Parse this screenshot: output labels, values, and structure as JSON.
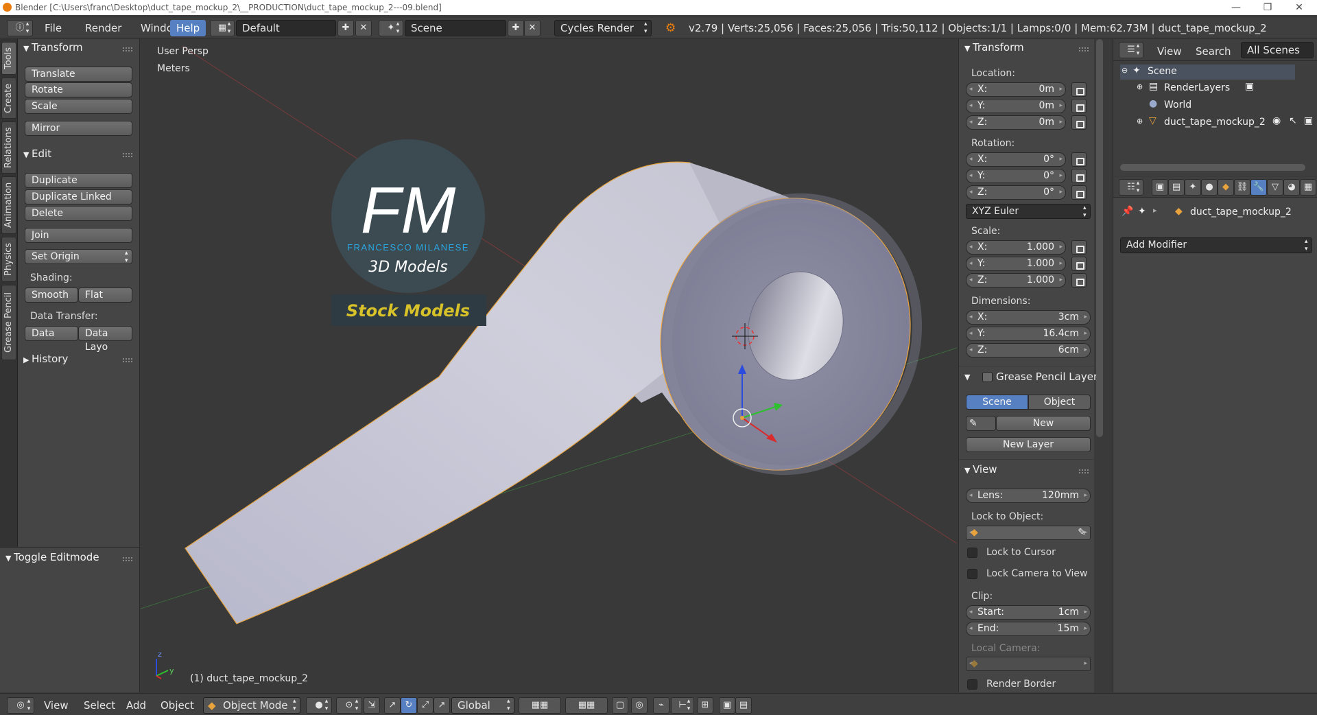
{
  "window": {
    "title": "Blender [C:\\Users\\franc\\Desktop\\duct_tape_mockup_2\\__PRODUCTION\\duct_tape_mockup_2---09.blend]",
    "controls": [
      "—",
      "❐",
      "✕"
    ]
  },
  "info": {
    "menus": [
      "File",
      "Render",
      "Window",
      "Help"
    ],
    "active_menu": "Help",
    "layout": "Default",
    "scene": "Scene",
    "engine": "Cycles Render",
    "stats": "v2.79 | Verts:25,056 | Faces:25,056 | Tris:50,112 | Objects:1/1 | Lamps:0/0 | Mem:62.73M | duct_tape_mockup_2"
  },
  "tabs": [
    "Tools",
    "Create",
    "Relations",
    "Animation",
    "Physics",
    "Grease Pencil"
  ],
  "toolshelf": {
    "transform_header": "Transform",
    "translate": "Translate",
    "rotate": "Rotate",
    "scale": "Scale",
    "mirror": "Mirror",
    "edit_header": "Edit",
    "duplicate": "Duplicate",
    "duplicate_linked": "Duplicate Linked",
    "delete": "Delete",
    "join": "Join",
    "set_origin": "Set Origin",
    "shading_label": "Shading:",
    "smooth": "Smooth",
    "flat": "Flat",
    "data_transfer_label": "Data Transfer:",
    "data": "Data",
    "data_layout": "Data Layo",
    "history_header": "History",
    "toggle_editmode": "Toggle Editmode"
  },
  "viewport": {
    "view_name": "User Persp",
    "units": "Meters",
    "object_label": "(1) duct_tape_mockup_2",
    "logo_initials": "FM",
    "logo_name": "FRANCESCO MILANESE",
    "logo_sub": "3D Models",
    "logo_banner": "Stock Models",
    "axis_z": "z",
    "axis_y": "y"
  },
  "npanel": {
    "transform_header": "Transform",
    "location_label": "Location:",
    "loc_x": "0m",
    "loc_y": "0m",
    "loc_z": "0m",
    "rotation_label": "Rotation:",
    "rot_x": "0°",
    "rot_y": "0°",
    "rot_z": "0°",
    "rotation_mode": "XYZ Euler",
    "scale_label": "Scale:",
    "scale_x": "1.000",
    "scale_y": "1.000",
    "scale_z": "1.000",
    "dimensions_label": "Dimensions:",
    "dim_x": "3cm",
    "dim_y": "16.4cm",
    "dim_z": "6cm",
    "x": "X:",
    "y": "Y:",
    "z": "Z:",
    "gp_header": "Grease Pencil Layer",
    "gp_scene": "Scene",
    "gp_object": "Object",
    "gp_new": "New",
    "gp_new_layer": "New Layer",
    "view_header": "View",
    "lens_label": "Lens:",
    "lens_value": "120mm",
    "lock_object_label": "Lock to Object:",
    "lock_cursor": "Lock to Cursor",
    "lock_camera": "Lock Camera to View",
    "clip_label": "Clip:",
    "clip_start_label": "Start:",
    "clip_start": "1cm",
    "clip_end_label": "End:",
    "clip_end": "15m",
    "local_camera_label": "Local Camera:",
    "render_border": "Render Border"
  },
  "outliner": {
    "view": "View",
    "search": "Search",
    "filter": "All Scenes",
    "scene": "Scene",
    "renderlayers": "RenderLayers",
    "world": "World",
    "object": "duct_tape_mockup_2"
  },
  "properties": {
    "object": "duct_tape_mockup_2",
    "add_modifier": "Add Modifier"
  },
  "bottombar": {
    "view": "View",
    "select": "Select",
    "add": "Add",
    "object": "Object",
    "mode": "Object Mode",
    "orientation": "Global"
  },
  "colors": {
    "accent_blue": "#5680c2",
    "selection_orange": "#e8a33c",
    "logo_blue": "#2aa7e0",
    "logo_yellow": "#d8c22a"
  }
}
